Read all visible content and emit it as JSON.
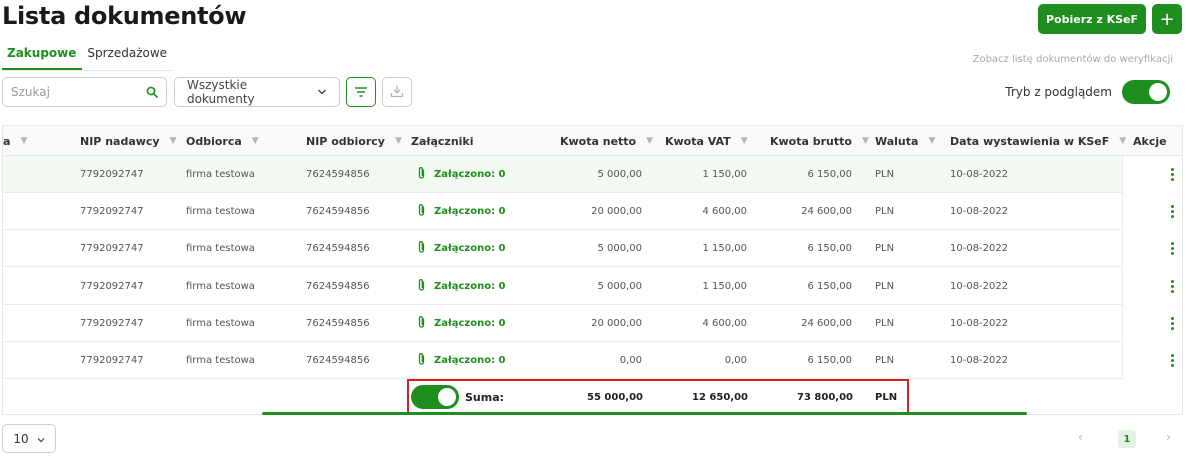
{
  "header": {
    "title": "Lista dokumentów",
    "fetch_ksef_label": "Pobierz z KSeF",
    "add_label": "+"
  },
  "tabs": [
    {
      "label": "Zakupowe",
      "active": true
    },
    {
      "label": "Sprzedażowe",
      "active": false
    }
  ],
  "verify_link": "Zobacz listę dokumentów do weryfikacji",
  "toolbar": {
    "search_placeholder": "Szukaj",
    "filter_select": "Wszystkie dokumenty",
    "preview_mode_label": "Tryb z podglądem",
    "preview_mode_on": true
  },
  "colors": {
    "accent": "#1e8f1e",
    "highlight_border": "#d9201f"
  },
  "table": {
    "columns": [
      "a",
      "NIP nadawcy",
      "Odbiorca",
      "NIP odbiorcy",
      "Załączniki",
      "Kwota netto",
      "Kwota VAT",
      "Kwota brutto",
      "Waluta",
      "Data wystawienia w KSeF",
      "Akcje"
    ],
    "rows": [
      {
        "nip_sender": "7792092747",
        "recipient": "firma testowa",
        "nip_recipient": "7624594856",
        "attachments": "Załączono: 0",
        "net": "5 000,00",
        "vat": "1 150,00",
        "gross": "6 150,00",
        "currency": "PLN",
        "date": "10-08-2022"
      },
      {
        "nip_sender": "7792092747",
        "recipient": "firma testowa",
        "nip_recipient": "7624594856",
        "attachments": "Załączono: 0",
        "net": "20 000,00",
        "vat": "4 600,00",
        "gross": "24 600,00",
        "currency": "PLN",
        "date": "10-08-2022"
      },
      {
        "nip_sender": "7792092747",
        "recipient": "firma testowa",
        "nip_recipient": "7624594856",
        "attachments": "Załączono: 0",
        "net": "5 000,00",
        "vat": "1 150,00",
        "gross": "6 150,00",
        "currency": "PLN",
        "date": "10-08-2022"
      },
      {
        "nip_sender": "7792092747",
        "recipient": "firma testowa",
        "nip_recipient": "7624594856",
        "attachments": "Załączono: 0",
        "net": "5 000,00",
        "vat": "1 150,00",
        "gross": "6 150,00",
        "currency": "PLN",
        "date": "10-08-2022"
      },
      {
        "nip_sender": "7792092747",
        "recipient": "firma testowa",
        "nip_recipient": "7624594856",
        "attachments": "Załączono: 0",
        "net": "20 000,00",
        "vat": "4 600,00",
        "gross": "24 600,00",
        "currency": "PLN",
        "date": "10-08-2022"
      },
      {
        "nip_sender": "7792092747",
        "recipient": "firma testowa",
        "nip_recipient": "7624594856",
        "attachments": "Załączono: 0",
        "net": "0,00",
        "vat": "0,00",
        "gross": "6 150,00",
        "currency": "PLN",
        "date": "10-08-2022"
      }
    ],
    "sum": {
      "label": "Suma:",
      "toggle_on": true,
      "net": "55 000,00",
      "vat": "12 650,00",
      "gross": "73 800,00",
      "currency": "PLN"
    }
  },
  "pagination": {
    "page_size": "10",
    "current_page": "1",
    "prev": "‹",
    "next": "›"
  }
}
